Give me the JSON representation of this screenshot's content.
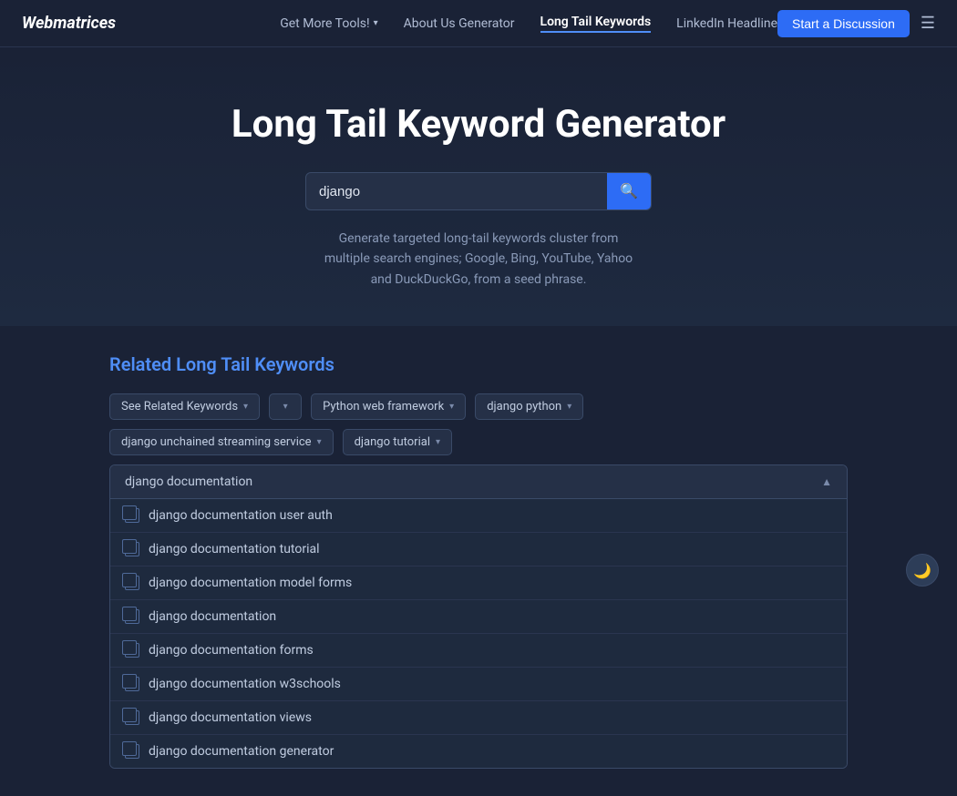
{
  "logo": "Webmatrices",
  "nav": {
    "links": [
      {
        "label": "Get More Tools!",
        "has_chevron": true,
        "active": false
      },
      {
        "label": "About Us Generator",
        "has_chevron": false,
        "active": false
      },
      {
        "label": "Long Tail Keywords",
        "has_chevron": false,
        "active": true
      },
      {
        "label": "LinkedIn Headline",
        "has_chevron": false,
        "active": false
      }
    ],
    "start_discussion": "Start a Discussion",
    "menu_icon": "☰"
  },
  "hero": {
    "title": "Long Tail Keyword Generator",
    "search_value": "django",
    "search_placeholder": "django",
    "search_icon": "🔍",
    "description": "Generate targeted long-tail keywords cluster from multiple search engines; Google, Bing, YouTube, Yahoo and DuckDuckGo, from a seed phrase."
  },
  "results": {
    "title_plain": "Related ",
    "title_highlight": "Long Tail Keywords",
    "filter_tags": [
      {
        "label": "See Related Keywords",
        "has_chevron": true
      },
      {
        "label": "",
        "has_chevron": true,
        "empty": true
      },
      {
        "label": "Python web framework",
        "has_chevron": true
      },
      {
        "label": "django python",
        "has_chevron": true
      }
    ],
    "filter_tags_row2": [
      {
        "label": "django unchained streaming service",
        "has_chevron": true
      },
      {
        "label": "django tutorial",
        "has_chevron": true
      }
    ],
    "dropdown": {
      "header": "django documentation",
      "items": [
        "django documentation user auth",
        "django documentation tutorial",
        "django documentation model forms",
        "django documentation",
        "django documentation forms",
        "django documentation w3schools",
        "django documentation views",
        "django documentation generator"
      ]
    }
  },
  "dark_toggle": "🌙"
}
